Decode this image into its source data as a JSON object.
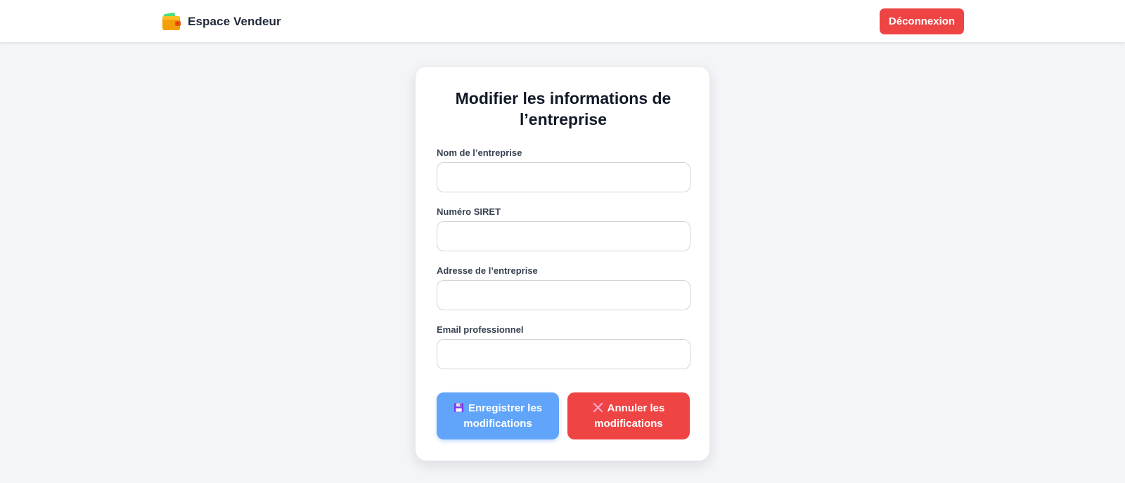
{
  "header": {
    "brand_icon": "wallet-icon",
    "brand_title": "Espace Vendeur",
    "logout_label": "Déconnexion",
    "logout_color": "#ef4444"
  },
  "form": {
    "title": "Modifier les informations de l’entreprise",
    "fields": [
      {
        "label": "Nom de l’entreprise",
        "value": "",
        "placeholder": ""
      },
      {
        "label": "Numéro SIRET",
        "value": "",
        "placeholder": ""
      },
      {
        "label": "Adresse de l’entreprise",
        "value": "",
        "placeholder": ""
      },
      {
        "label": "Email professionnel",
        "value": "",
        "placeholder": ""
      }
    ],
    "save_button": {
      "icon": "floppy-disk-icon",
      "label": "Enregistrer les modifications",
      "color": "#60a5fa"
    },
    "cancel_button": {
      "icon": "cross-mark-icon",
      "label": "Annuler les modifications",
      "color": "#ef4444"
    }
  }
}
